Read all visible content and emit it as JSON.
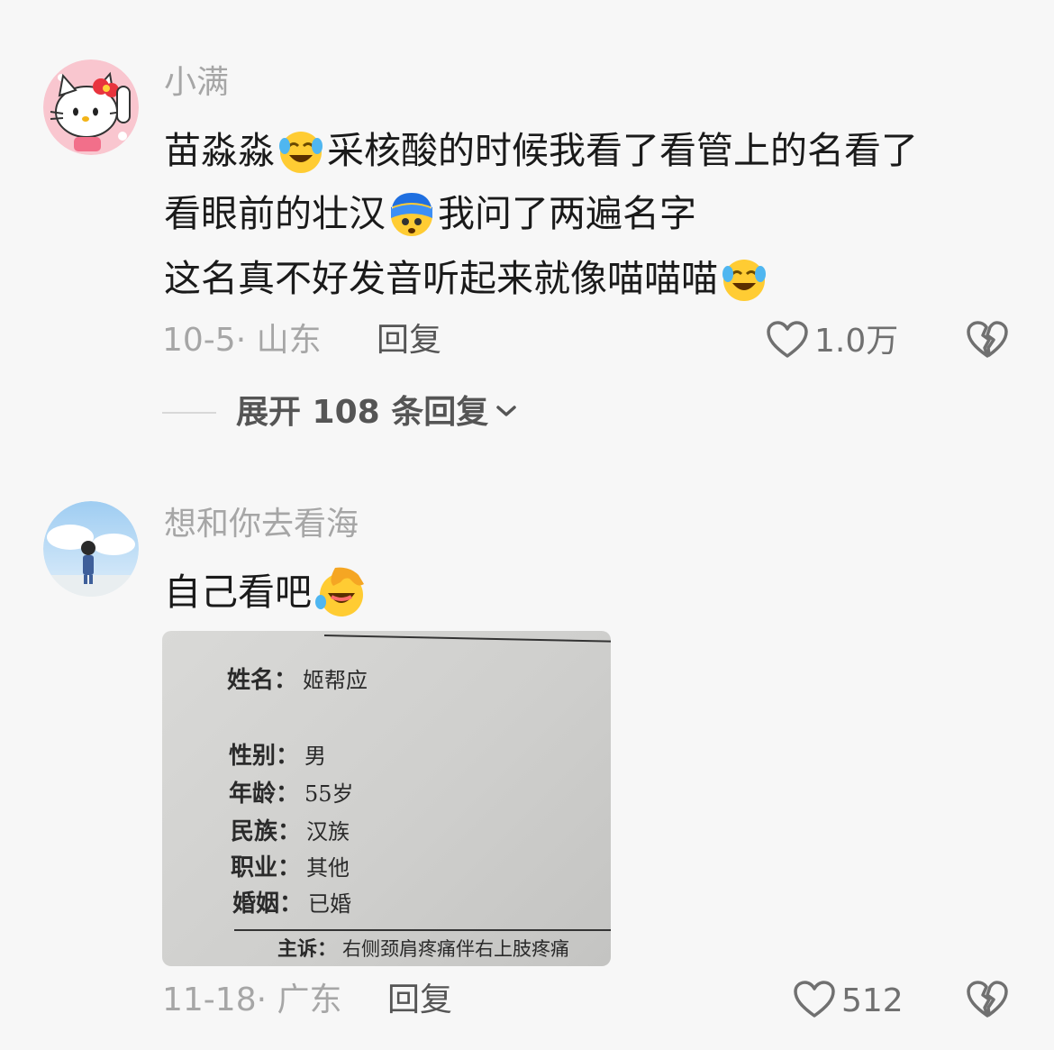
{
  "comments": [
    {
      "username": "小满",
      "lines": [
        {
          "before": "苗淼淼",
          "emoji": "laugh-cry-emoji",
          "after": "采核酸的时候我看了看管上的名看了"
        },
        {
          "before": "看眼前的壮汉",
          "emoji": "shocked-blue-emoji",
          "after": "我问了两遍名字"
        },
        {
          "before": "这名真不好发音听起来就像喵喵喵",
          "emoji": "laugh-cry-emoji",
          "after": ""
        }
      ],
      "date_location": "10-5· 山东",
      "reply_label": "回复",
      "likes": "1.0万",
      "expand_label": "展开 108 条回复"
    },
    {
      "username": "想和你去看海",
      "lines": [
        {
          "before": "自己看吧",
          "emoji": "facepalm-laugh-emoji",
          "after": ""
        }
      ],
      "photo": {
        "rows": [
          {
            "label": "姓名：",
            "value": "姬帮应"
          },
          {
            "label": "性别：",
            "value": "男"
          },
          {
            "label": "年龄：",
            "value": "55岁"
          },
          {
            "label": "民族：",
            "value": "汉族"
          },
          {
            "label": "职业：",
            "value": "其他"
          },
          {
            "label": "婚姻：",
            "value": "已婚"
          },
          {
            "label": "主诉：",
            "value": "右侧颈肩疼痛伴右上肢疼痛"
          }
        ]
      },
      "date_location": "11-18· 广东",
      "reply_label": "回复",
      "likes": "512"
    }
  ],
  "colors": {
    "background": "#f7f7f7",
    "text_primary": "#1a1a1a",
    "text_secondary": "#a6a6a6"
  }
}
